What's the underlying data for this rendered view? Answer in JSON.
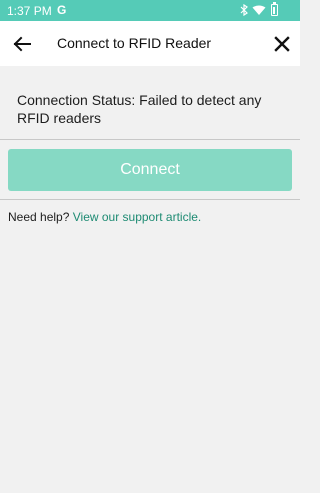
{
  "status_bar": {
    "time": "1:37 PM",
    "carrier_glyph": "G",
    "icons": [
      "bluetooth-icon",
      "wifi-icon",
      "battery-icon"
    ]
  },
  "app_bar": {
    "title": "Connect to RFID Reader",
    "back_icon": "arrow-left-icon",
    "close_icon": "close-icon"
  },
  "connection": {
    "status_text": "Connection Status: Failed to detect any RFID readers"
  },
  "connect_button": {
    "label": "Connect"
  },
  "help": {
    "prefix": "Need help?",
    "link_text": "View our support article."
  },
  "colors": {
    "accent": "#55cbb7",
    "button": "#86d9c4",
    "link": "#1e8b73",
    "background": "#f1f1f1"
  }
}
